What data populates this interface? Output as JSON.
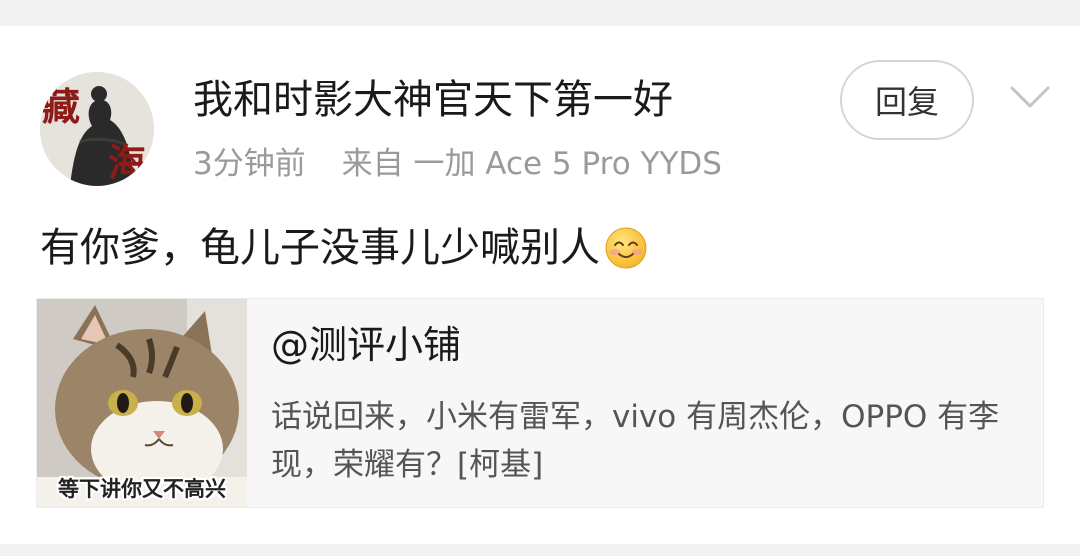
{
  "comment": {
    "username": "我和时影大神官天下第一好",
    "time": "3分钟前",
    "source": "来自 一加 Ace 5 Pro YYDS",
    "reply_label": "回复",
    "text": "有你爹，龟儿子没事儿少喊别人",
    "emoji": "smile-emoji",
    "avatar_chars": [
      "藏",
      "海"
    ]
  },
  "quote": {
    "author": "@测评小铺",
    "body": "话说回来，小米有雷军，vivo 有周杰伦，OPPO 有李现，荣耀有？[柯基]",
    "image_caption": "等下讲你又不高兴"
  },
  "icons": {
    "expand": "chevron-down-icon",
    "avatar": "avatar-ink-figure",
    "quote_image": "cat-meme-image"
  },
  "colors": {
    "background": "#f2f2f2",
    "card": "#ffffff",
    "primary_text": "#1a1a1a",
    "secondary_text": "#9a9a9a",
    "quote_bg": "#f7f7f7",
    "avatar_red": "#8e1b17"
  }
}
